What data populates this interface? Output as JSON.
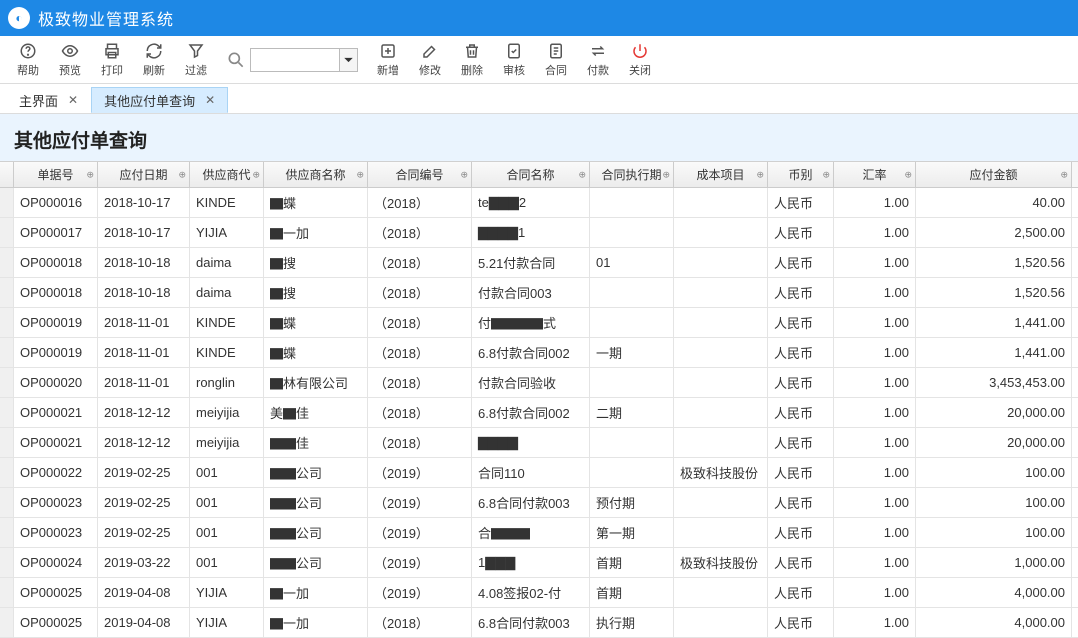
{
  "app_title": "极致物业管理系统",
  "toolbar": {
    "help": "帮助",
    "preview": "预览",
    "print": "打印",
    "refresh": "刷新",
    "filter": "过滤",
    "add": "新增",
    "edit": "修改",
    "delete": "删除",
    "audit": "审核",
    "contract": "合同",
    "pay": "付款",
    "close": "关闭"
  },
  "search": {
    "placeholder": ""
  },
  "tabs": [
    {
      "label": "主界面",
      "active": false
    },
    {
      "label": "其他应付单查询",
      "active": true
    }
  ],
  "page_title": "其他应付单查询",
  "columns": [
    "单据号",
    "应付日期",
    "供应商代",
    "供应商名称",
    "合同编号",
    "合同名称",
    "合同执行期",
    "成本项目",
    "币别",
    "汇率",
    "应付金额"
  ],
  "rows": [
    {
      "dh": "OP000016",
      "date": "2018-10-17",
      "sc": "KINDE",
      "sn": "▇蝶",
      "ce": "（2018）",
      "cn": "te▇▇▇2",
      "cp": "",
      "ci": "",
      "cur": "人民币",
      "rate": "1.00",
      "amt": "40.00"
    },
    {
      "dh": "OP000017",
      "date": "2018-10-17",
      "sc": "YIJIA",
      "sn": "▇一加",
      "ce": "（2018）",
      "cn": "▇▇▇▇1",
      "cp": "",
      "ci": "",
      "cur": "人民币",
      "rate": "1.00",
      "amt": "2,500.00"
    },
    {
      "dh": "OP000018",
      "date": "2018-10-18",
      "sc": "daima",
      "sn": "▇搜",
      "ce": "（2018）",
      "cn": "5.21付款合同",
      "cp": "01",
      "ci": "",
      "cur": "人民币",
      "rate": "1.00",
      "amt": "1,520.56"
    },
    {
      "dh": "OP000018",
      "date": "2018-10-18",
      "sc": "daima",
      "sn": "▇搜",
      "ce": "（2018）",
      "cn": "付款合同003",
      "cp": "",
      "ci": "",
      "cur": "人民币",
      "rate": "1.00",
      "amt": "1,520.56"
    },
    {
      "dh": "OP000019",
      "date": "2018-11-01",
      "sc": "KINDE",
      "sn": "▇蝶",
      "ce": "（2018）",
      "cn": "付▇▇▇▇式",
      "cp": "",
      "ci": "",
      "cur": "人民币",
      "rate": "1.00",
      "amt": "1,441.00"
    },
    {
      "dh": "OP000019",
      "date": "2018-11-01",
      "sc": "KINDE",
      "sn": "▇蝶",
      "ce": "（2018）",
      "cn": "6.8付款合同002",
      "cp": "一期",
      "ci": "",
      "cur": "人民币",
      "rate": "1.00",
      "amt": "1,441.00"
    },
    {
      "dh": "OP000020",
      "date": "2018-11-01",
      "sc": "ronglin",
      "sn": "▇林有限公司",
      "ce": "（2018）",
      "cn": "付款合同验收",
      "cp": "",
      "ci": "",
      "cur": "人民币",
      "rate": "1.00",
      "amt": "3,453,453.00"
    },
    {
      "dh": "OP000021",
      "date": "2018-12-12",
      "sc": "meiyijia",
      "sn": "美▇佳",
      "ce": "（2018）",
      "cn": "6.8付款合同002",
      "cp": "二期",
      "ci": "",
      "cur": "人民币",
      "rate": "1.00",
      "amt": "20,000.00"
    },
    {
      "dh": "OP000021",
      "date": "2018-12-12",
      "sc": "meiyijia",
      "sn": "▇▇佳",
      "ce": "（2018）",
      "cn": "▇▇▇▇",
      "cp": "",
      "ci": "",
      "cur": "人民币",
      "rate": "1.00",
      "amt": "20,000.00"
    },
    {
      "dh": "OP000022",
      "date": "2019-02-25",
      "sc": "001",
      "sn": "▇▇公司",
      "ce": "（2019）",
      "cn": "合同110",
      "cp": "",
      "ci": "极致科技股份",
      "cur": "人民币",
      "rate": "1.00",
      "amt": "100.00"
    },
    {
      "dh": "OP000023",
      "date": "2019-02-25",
      "sc": "001",
      "sn": "▇▇公司",
      "ce": "（2019）",
      "cn": "6.8合同付款003",
      "cp": "预付期",
      "ci": "",
      "cur": "人民币",
      "rate": "1.00",
      "amt": "100.00"
    },
    {
      "dh": "OP000023",
      "date": "2019-02-25",
      "sc": "001",
      "sn": "▇▇公司",
      "ce": "（2019）",
      "cn": "合▇▇▇",
      "cp": "第一期",
      "ci": "",
      "cur": "人民币",
      "rate": "1.00",
      "amt": "100.00"
    },
    {
      "dh": "OP000024",
      "date": "2019-03-22",
      "sc": "001",
      "sn": "▇▇公司",
      "ce": "（2019）",
      "cn": "1▇▇▇",
      "cp": "首期",
      "ci": "极致科技股份",
      "cur": "人民币",
      "rate": "1.00",
      "amt": "1,000.00"
    },
    {
      "dh": "OP000025",
      "date": "2019-04-08",
      "sc": "YIJIA",
      "sn": "▇一加",
      "ce": "（2019）",
      "cn": "4.08签报02-付",
      "cp": "首期",
      "ci": "",
      "cur": "人民币",
      "rate": "1.00",
      "amt": "4,000.00"
    },
    {
      "dh": "OP000025",
      "date": "2019-04-08",
      "sc": "YIJIA",
      "sn": "▇一加",
      "ce": "（2018）",
      "cn": "6.8合同付款003",
      "cp": "执行期",
      "ci": "",
      "cur": "人民币",
      "rate": "1.00",
      "amt": "4,000.00"
    }
  ]
}
